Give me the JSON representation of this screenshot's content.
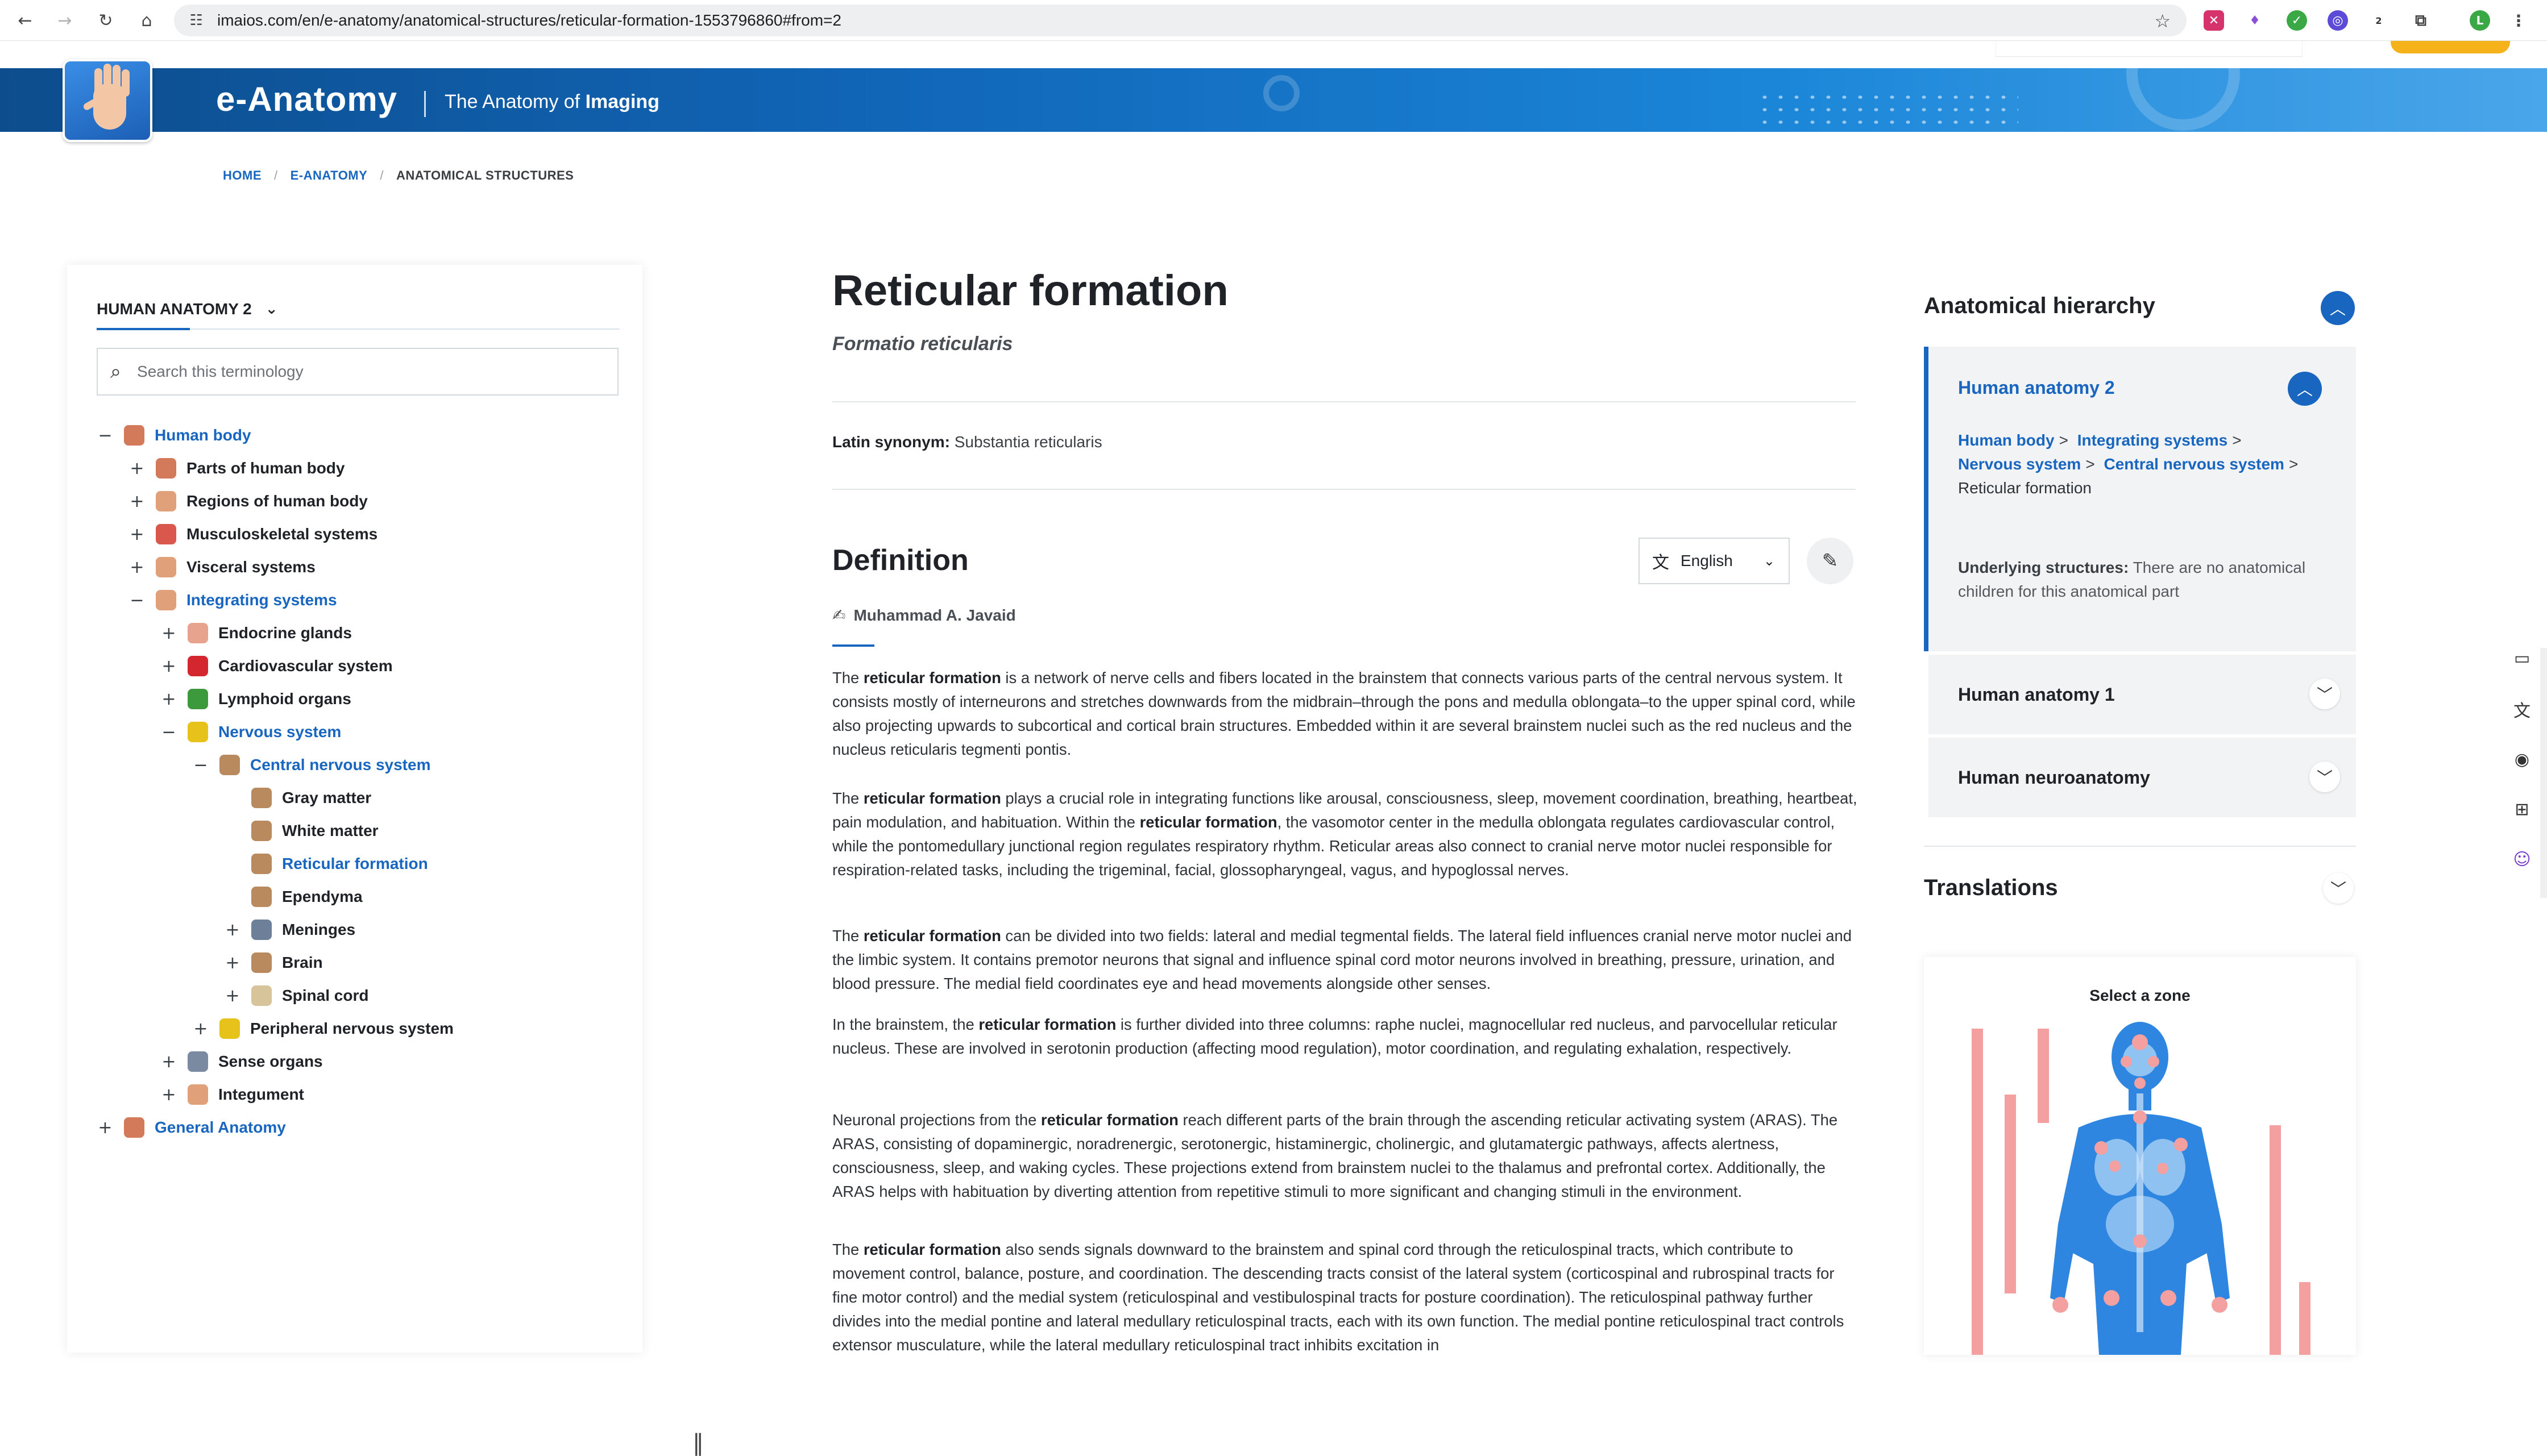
{
  "browser": {
    "url": "imaios.com/en/e-anatomy/anatomical-structures/reticular-formation-1553796860#from=2",
    "extension_badge": "2",
    "profile_initial": "L"
  },
  "header": {
    "site_title": "e-Anatomy",
    "tagline_prefix": "The Anatomy of",
    "tagline_bold": "Imaging"
  },
  "breadcrumb": [
    {
      "label": "HOME"
    },
    {
      "label": "E-ANATOMY"
    },
    {
      "label": "ANATOMICAL STRUCTURES"
    }
  ],
  "sidebar": {
    "terminology": "HUMAN ANATOMY 2",
    "search_placeholder": "Search this terminology",
    "tree": [
      {
        "label": "Human body",
        "toggle": "−",
        "level": 0,
        "link": true,
        "icon_color": "#d27a5a"
      },
      {
        "label": "Parts of human body",
        "toggle": "+",
        "level": 1,
        "link": false,
        "icon_color": "#d27a5a"
      },
      {
        "label": "Regions of human body",
        "toggle": "+",
        "level": 1,
        "link": false,
        "icon_color": "#e0a07a"
      },
      {
        "label": "Musculoskeletal systems",
        "toggle": "+",
        "level": 1,
        "link": false,
        "icon_color": "#d9574c"
      },
      {
        "label": "Visceral systems",
        "toggle": "+",
        "level": 1,
        "link": false,
        "icon_color": "#e0a07a"
      },
      {
        "label": "Integrating systems",
        "toggle": "−",
        "level": 1,
        "link": true,
        "icon_color": "#e0a07a"
      },
      {
        "label": "Endocrine glands",
        "toggle": "+",
        "level": 2,
        "link": false,
        "icon_color": "#e8a38e"
      },
      {
        "label": "Cardiovascular system",
        "toggle": "+",
        "level": 2,
        "link": false,
        "icon_color": "#d4262e"
      },
      {
        "label": "Lymphoid organs",
        "toggle": "+",
        "level": 2,
        "link": false,
        "icon_color": "#3c9a3c"
      },
      {
        "label": "Nervous system",
        "toggle": "−",
        "level": 2,
        "link": true,
        "icon_color": "#e6c21a"
      },
      {
        "label": "Central nervous system",
        "toggle": "−",
        "level": 3,
        "link": true,
        "icon_color": "#b98a5e"
      },
      {
        "label": "Gray matter",
        "toggle": "",
        "level": 4,
        "link": false,
        "icon_color": "#b98a5e"
      },
      {
        "label": "White matter",
        "toggle": "",
        "level": 4,
        "link": false,
        "icon_color": "#b98a5e"
      },
      {
        "label": "Reticular formation",
        "toggle": "",
        "level": 4,
        "link": true,
        "icon_color": "#b98a5e"
      },
      {
        "label": "Ependyma",
        "toggle": "",
        "level": 4,
        "link": false,
        "icon_color": "#b98a5e"
      },
      {
        "label": "Meninges",
        "toggle": "+",
        "level": 4,
        "link": false,
        "icon_color": "#6e7f9a"
      },
      {
        "label": "Brain",
        "toggle": "+",
        "level": 4,
        "link": false,
        "icon_color": "#b98a5e"
      },
      {
        "label": "Spinal cord",
        "toggle": "+",
        "level": 4,
        "link": false,
        "icon_color": "#d8c49a"
      },
      {
        "label": "Peripheral nervous system",
        "toggle": "+",
        "level": 3,
        "link": false,
        "icon_color": "#e6c21a"
      },
      {
        "label": "Sense organs",
        "toggle": "+",
        "level": 2,
        "link": false,
        "icon_color": "#7a8aa0"
      },
      {
        "label": "Integument",
        "toggle": "+",
        "level": 2,
        "link": false,
        "icon_color": "#e0a07a"
      },
      {
        "label": "General Anatomy",
        "toggle": "+",
        "level": 0,
        "link": true,
        "icon_color": "#d27a5a"
      }
    ]
  },
  "main": {
    "title": "Reticular formation",
    "latin_name": "Formatio reticularis",
    "latin_synonym_label": "Latin synonym:",
    "latin_synonym_value": "Substantia reticularis",
    "definition_title": "Definition",
    "language": "English",
    "author": "Muhammad A. Javaid",
    "paragraphs": [
      [
        {
          "t": "The "
        },
        {
          "t": "reticular formation",
          "b": true
        },
        {
          "t": " is a network of nerve cells and fibers located in the brainstem that connects various parts of the central nervous system. It consists mostly of interneurons and stretches downwards from the midbrain–through the pons and medulla oblongata–to the upper spinal cord, while also projecting upwards to subcortical and cortical brain structures. Embedded within it are several brainstem nuclei such as the red nucleus and the nucleus reticularis tegmenti pontis."
        }
      ],
      [
        {
          "t": "The "
        },
        {
          "t": "reticular formation",
          "b": true
        },
        {
          "t": " plays a crucial role in integrating functions like arousal, consciousness, sleep, movement coordination, breathing, heartbeat, pain modulation, and habituation. Within the "
        },
        {
          "t": "reticular formation",
          "b": true
        },
        {
          "t": ", the vasomotor center in the medulla oblongata regulates cardiovascular control, while the pontomedullary junctional region regulates respiratory rhythm. Reticular areas also connect to cranial nerve motor nuclei responsible for respiration-related tasks, including the trigeminal, facial, glossopharyngeal, vagus, and hypoglossal nerves."
        }
      ],
      [
        {
          "t": "The "
        },
        {
          "t": "reticular formation",
          "b": true
        },
        {
          "t": " can be divided into two fields: lateral and medial tegmental fields. The lateral field influences cranial nerve motor nuclei and the limbic system. It contains premotor neurons that signal and influence spinal cord motor neurons involved in breathing, pressure, urination, and blood pressure. The medial field coordinates eye and head movements alongside other senses."
        }
      ],
      [
        {
          "t": "In the brainstem, the "
        },
        {
          "t": "reticular formation",
          "b": true
        },
        {
          "t": " is further divided into three columns: raphe nuclei, magnocellular red nucleus, and parvocellular reticular nucleus. These are involved in serotonin production (affecting mood regulation), motor coordination, and regulating exhalation, respectively."
        }
      ],
      [
        {
          "t": "Neuronal projections from the "
        },
        {
          "t": "reticular formation",
          "b": true
        },
        {
          "t": " reach different parts of the brain through the ascending reticular activating system (ARAS). The ARAS, consisting of dopaminergic, noradrenergic, serotonergic, histaminergic, cholinergic, and glutamatergic pathways, affects alertness, consciousness, sleep, and waking cycles. These projections extend from brainstem nuclei to the thalamus and prefrontal cortex. Additionally, the ARAS helps with habituation by diverting attention from repetitive stimuli to more significant and changing stimuli in the environment."
        }
      ],
      [
        {
          "t": "The "
        },
        {
          "t": "reticular formation",
          "b": true
        },
        {
          "t": " also sends signals downward to the brainstem and spinal cord through the reticulospinal tracts, which contribute to movement control, balance, posture, and coordination. The descending tracts consist of the lateral system (corticospinal and rubrospinal tracts for fine motor control) and the medial system (reticulospinal and vestibulospinal tracts for posture coordination). The reticulospinal pathway further divides into the medial pontine and lateral medullary reticulospinal tracts, each with its own function. The medial pontine reticulospinal tract controls extensor musculature, while the lateral medullary reticulospinal tract inhibits excitation in"
        }
      ]
    ]
  },
  "right_panel": {
    "hierarchy_title": "Anatomical hierarchy",
    "active_terminology": "Human anatomy 2",
    "path": [
      "Human body",
      "Integrating systems",
      "Nervous system",
      "Central nervous system"
    ],
    "path_current": "Reticular formation",
    "underlying_label": "Underlying structures:",
    "underlying_value": "There are no anatomical children for this anatomical part",
    "other_terminologies": [
      "Human anatomy 1",
      "Human neuroanatomy"
    ],
    "translations_title": "Translations",
    "zone_title": "Select a zone"
  },
  "colors": {
    "accent": "#1866c0",
    "header_start": "#0d4d8d",
    "header_end": "#4aa6ea",
    "cta": "#f6b21a",
    "zone_bars": "#f4a0a0",
    "body_figure": "#2f86e0"
  }
}
